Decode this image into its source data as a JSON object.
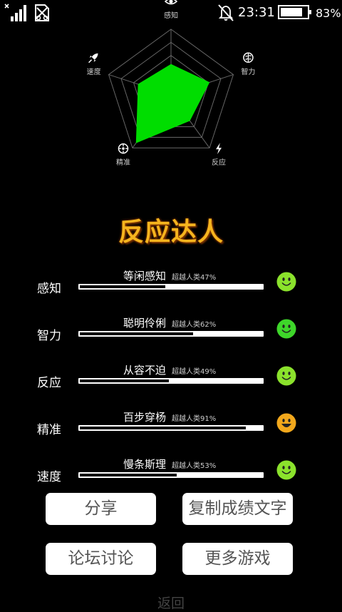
{
  "status_bar": {
    "signal_icon": "signal-bars-icon",
    "sim_icon": "no-sim-icon",
    "mute_icon": "bell-off-icon",
    "time": "23:31",
    "battery_level": 0.83,
    "battery_text": "83%"
  },
  "radar": {
    "axes": [
      {
        "label": "感知",
        "icon": "eye-icon",
        "value": 0.47
      },
      {
        "label": "智力",
        "icon": "brain-icon",
        "value": 0.62
      },
      {
        "label": "反应",
        "icon": "lightning-icon",
        "value": 0.49
      },
      {
        "label": "精准",
        "icon": "target-icon",
        "value": 0.91
      },
      {
        "label": "速度",
        "icon": "rocket-icon",
        "value": 0.53
      }
    ],
    "fill_color": "#00dd00",
    "grid_color": "#666666"
  },
  "result_title": "反应达人",
  "stats": [
    {
      "name": "感知",
      "desc": "等闲感知",
      "pct_text": "超越人类47%",
      "value": 0.47,
      "face": "smile",
      "face_color": "#8be22c"
    },
    {
      "name": "智力",
      "desc": "聪明伶俐",
      "pct_text": "超越人类62%",
      "value": 0.62,
      "face": "smile",
      "face_color": "#3ed62a"
    },
    {
      "name": "反应",
      "desc": "从容不迫",
      "pct_text": "超越人类49%",
      "value": 0.49,
      "face": "smile",
      "face_color": "#8be22c"
    },
    {
      "name": "精准",
      "desc": "百步穿杨",
      "pct_text": "超越人类91%",
      "value": 0.91,
      "face": "grin",
      "face_color": "#f2a81c"
    },
    {
      "name": "速度",
      "desc": "慢条斯理",
      "pct_text": "超越人类53%",
      "value": 0.53,
      "face": "smile",
      "face_color": "#8be22c"
    }
  ],
  "buttons": {
    "share": "分享",
    "copy_text": "复制成绩文字",
    "forum": "论坛讨论",
    "more_games": "更多游戏"
  },
  "back_label": "返回"
}
